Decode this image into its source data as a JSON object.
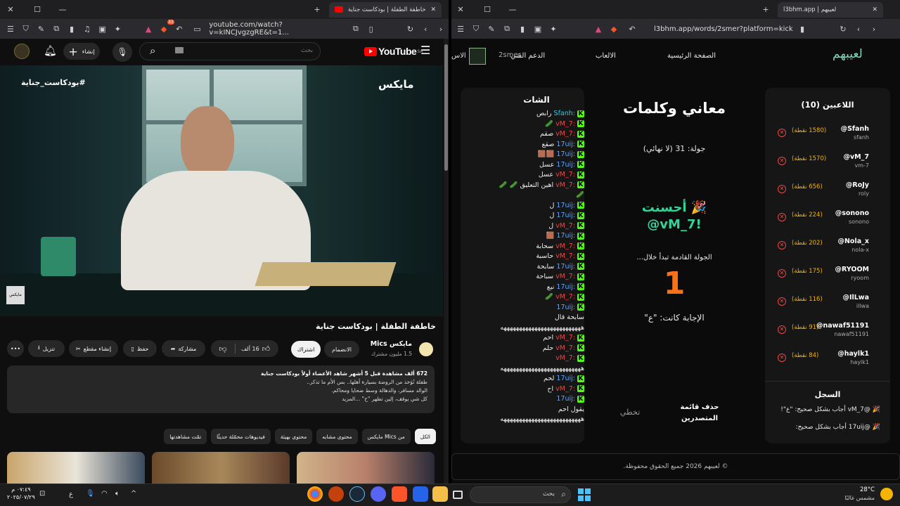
{
  "left_window": {
    "tab_title": "خاطفة الطفلة | بودكاست جناية",
    "tab_badge": "33",
    "url": "youtube.com/watch?v=kINCJvgzgRE&t=1...",
    "youtube": {
      "logo_text": "YouTube",
      "logo_region": "SA",
      "search_placeholder": "بحث",
      "create_label": "إنشاء",
      "video_hashtag": "#بودكاست_جناية",
      "channel_watermark": "مايكس",
      "video_title": "خاطفة الطفلة | بودكاست جناية",
      "channel_name": "مايكس Mics",
      "subscriber_count": "1.5 مليون مشترك",
      "join_label": "الانضمام",
      "subscribe_label": "اشتراك",
      "likes": "16 ألف",
      "share_label": "مشاركة",
      "save_label": "حفظ",
      "clip_label": "إنشاء مقطع",
      "download_label": "تنزيل",
      "more_label": "•••",
      "description_line1": "672 ألف مشاهدة  قبل 5 أشهر  شاهد الأعضاء أولاً  بودكاست جناية",
      "description_line2": "طفلة تُؤخذ من الروضة بسيارة أهلها.. بس الأم ما تذكر..",
      "description_line3": "الوالد مسافر، والدهالة وسط ضحايا ومحاكم.",
      "description_line4": "كل شي يوقف، إلين تظهر \"ح\"  ...المزيد",
      "chips": [
        "الكل",
        "من Mics مايكس",
        "محتوى مشابه",
        "محتوى بهيئة",
        "فيديوهات محمّلة حديثًا",
        "تمّت مشاهدتها"
      ]
    }
  },
  "right_window": {
    "tab_title": "لعيبهم | l3bhm.app",
    "url": "l3bhm.app/words/2smer?platform=kick",
    "nav": {
      "logo": "لعيبهم",
      "home": "الصفحة الرئيسية",
      "games": "الالعاب",
      "support": "الدعم الفني",
      "streamer": "2smer",
      "cut_text": "الاس"
    },
    "players": {
      "title": "اللاعبين (10)",
      "list": [
        {
          "name": "@Sfanh",
          "user": "sfanh",
          "points": "(1580 نقطة)"
        },
        {
          "name": "@vM_7",
          "user": "vm-7",
          "points": "(1570 نقطة)"
        },
        {
          "name": "@RoJy",
          "user": "roly",
          "points": "(656 نقطة)"
        },
        {
          "name": "@sonono",
          "user": "sonono",
          "points": "(224 نقطة)"
        },
        {
          "name": "@Nola_x",
          "user": "nola-x",
          "points": "(202 نقطة)"
        },
        {
          "name": "@RYOOM",
          "user": "ryoom",
          "points": "(175 نقطة)"
        },
        {
          "name": "@IlLwa",
          "user": "illwa",
          "points": "(116 نقطة)"
        },
        {
          "name": "@nawaf51191",
          "user": "nawaf51191",
          "points": "(91 نقطة)"
        },
        {
          "name": "@haylk1",
          "user": "haylk1",
          "points": "(84 نقطة)"
        }
      ]
    },
    "log": {
      "title": "السجل",
      "entries": [
        "🎉 @vM_7 أجاب بشكل صحيح: \"ع\"!",
        "🎉 @17uij أجاب بشكل صحيح:"
      ]
    },
    "game": {
      "title": "معاني وكلمات",
      "round": "جولة: 31 (لا نهائي)",
      "well_done": "🎉 أحسنت",
      "winner": "@vM_7!",
      "next_round": "الجولة القادمة تبدأ خلال...",
      "countdown": "1",
      "answer": "الإجابة كانت: \"ع\"",
      "delete_leaderboard": "حذف قائمة المتصدرين",
      "skip": "تخطي"
    },
    "chat": {
      "title": "الشات",
      "messages": [
        {
          "user": "Sfanh:",
          "text": "رابص",
          "c": "nm3"
        },
        {
          "user": "vM_7:",
          "text": "🥒",
          "c": "nm1"
        },
        {
          "user": "vM_7:",
          "text": "صقم",
          "c": "nm1"
        },
        {
          "user": "17uij:",
          "text": "صقع",
          "c": "nm2"
        },
        {
          "user": "17uij:",
          "text": "🟫🟫",
          "c": "nm2"
        },
        {
          "user": "17uij:",
          "text": "عسل",
          "c": "nm2"
        },
        {
          "user": "vM_7:",
          "text": "عسل",
          "c": "nm1"
        },
        {
          "user": "vM_7:",
          "text": "اهين التعليق 🥒 🥒",
          "c": "nm1"
        },
        {
          "user": "",
          "text": "🥒",
          "c": "nm1"
        },
        {
          "user": "17uij:",
          "text": "ل",
          "c": "nm2"
        },
        {
          "user": "17uij:",
          "text": "ل",
          "c": "nm2"
        },
        {
          "user": "vM_7:",
          "text": "ل",
          "c": "nm1"
        },
        {
          "user": "17uij:",
          "text": "🟫",
          "c": "nm2"
        },
        {
          "user": "vM_7:",
          "text": "سحابة",
          "c": "nm1"
        },
        {
          "user": "vM_7:",
          "text": "حاسبة",
          "c": "nm1"
        },
        {
          "user": "17uij:",
          "text": "سابحة",
          "c": "nm2"
        },
        {
          "user": "vM_7:",
          "text": "سباحة",
          "c": "nm1"
        },
        {
          "user": "17uij:",
          "text": "نبع",
          "c": "nm2"
        },
        {
          "user": "vM_7:",
          "text": "🥒",
          "c": "nm1"
        },
        {
          "user": "17uij:",
          "text": "",
          "c": "nm2"
        },
        {
          "user": "",
          "text": "سابحة قال",
          "c": "nm2"
        },
        {
          "user": "",
          "text": "ههههههههههههههههههههههههههه",
          "c": "nm2"
        },
        {
          "user": "vM_7:",
          "text": "احم",
          "c": "nm1"
        },
        {
          "user": "vM_7:",
          "text": "حلم",
          "c": "nm1"
        },
        {
          "user": "vM_7:",
          "text": "",
          "c": "nm1"
        },
        {
          "user": "",
          "text": "ههههههههههههههههههههههههههه",
          "c": "nm1"
        },
        {
          "user": "17uij:",
          "text": "لحم",
          "c": "nm2"
        },
        {
          "user": "vM_7:",
          "text": "اح",
          "c": "nm1"
        },
        {
          "user": "17uij:",
          "text": "",
          "c": "nm2"
        },
        {
          "user": "",
          "text": "يقول احم",
          "c": "nm2"
        },
        {
          "user": "",
          "text": "ههههههههههههههههههههههههههه",
          "c": "nm2"
        }
      ]
    },
    "footer": "© لعيبهم 2026 جميع الحقوق محفوظة."
  },
  "taskbar": {
    "search_placeholder": "بحث",
    "weather_temp": "28°C",
    "weather_text": "مشمس غالبًا",
    "time": "٠٧:٤٩ م",
    "date": "٢٠٢٥/٠٧/٢٩",
    "lang": "ع"
  }
}
